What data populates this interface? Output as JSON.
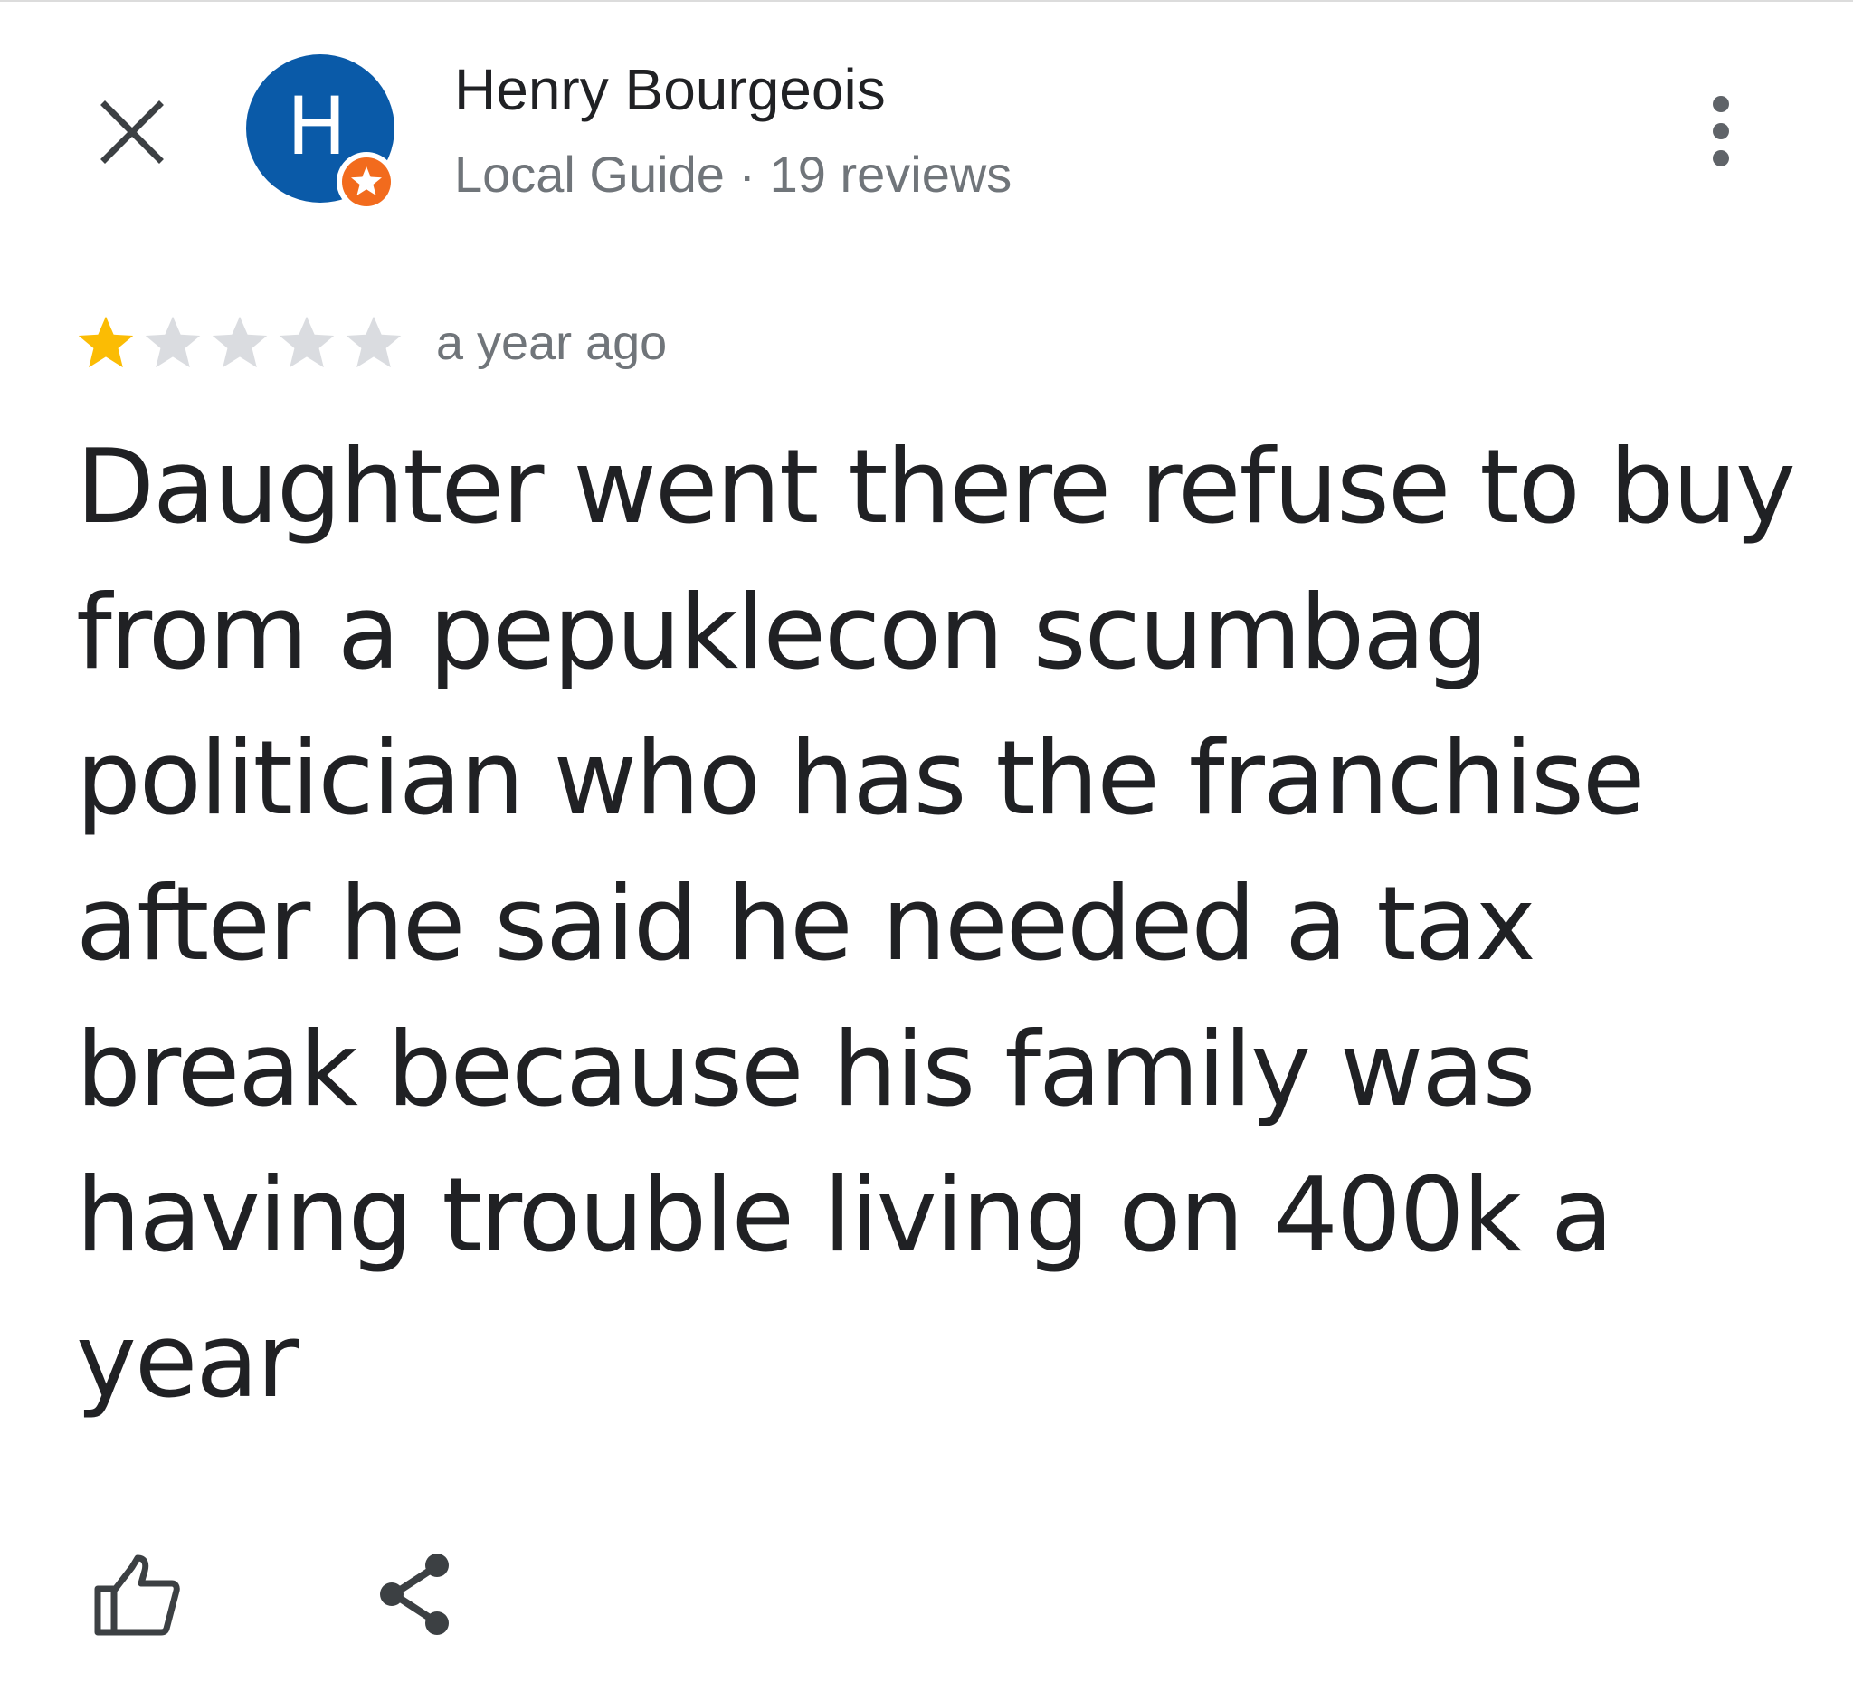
{
  "header": {
    "close_icon": "close-icon",
    "avatar_letter": "H",
    "avatar_color": "#0a5aa8",
    "badge_color": "#f26b1d",
    "badge_icon": "local-guide-star-icon",
    "author_name": "Henry Bourgeois",
    "author_meta": "Local Guide · 19 reviews",
    "more_icon": "more-vertical-icon"
  },
  "review": {
    "rating": 1,
    "rating_max": 5,
    "star_filled_color": "#fbbc04",
    "star_empty_color": "#dadce0",
    "time": "a year ago",
    "text_lines": [
      "Daughter went there refuse to buy",
      "from a pepuklecon scumbag",
      "politician who has the franchise",
      "after he said he needed a tax",
      "break because his family was",
      "having trouble living on 400k a",
      "year"
    ]
  },
  "actions": {
    "like_icon": "thumbs-up-icon",
    "share_icon": "share-icon"
  }
}
